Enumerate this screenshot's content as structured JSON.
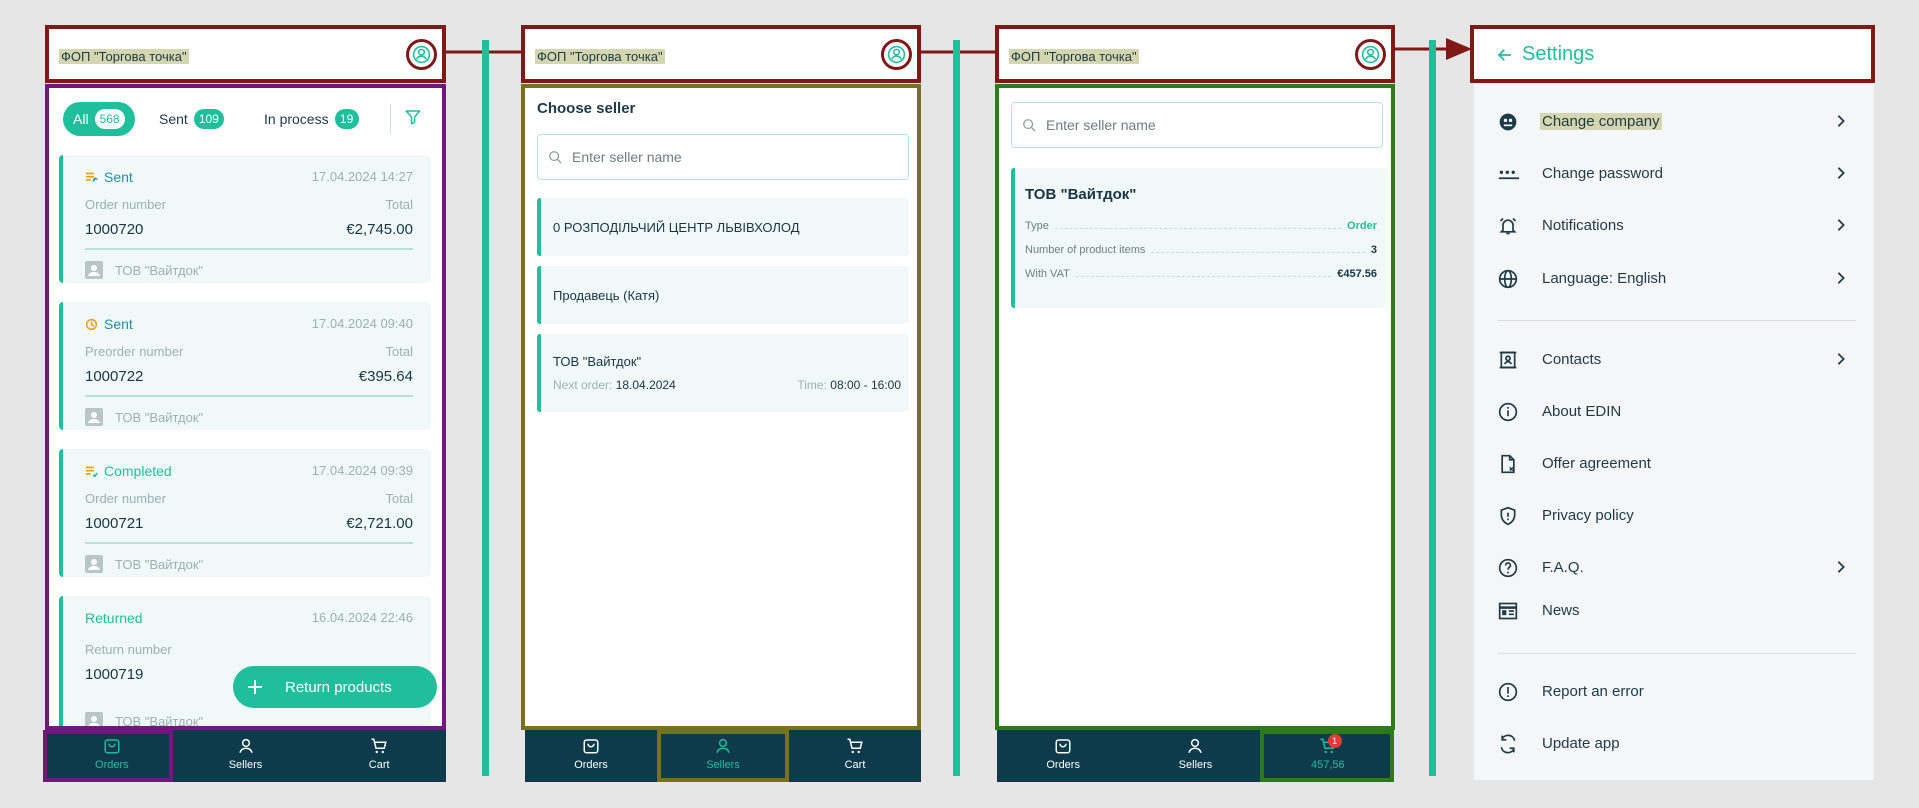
{
  "company_name": "ФОП \"Торгова точка\"",
  "colors": {
    "accent": "#1fbf9b",
    "nav_bg": "#0d3b4c",
    "callout": "#801818",
    "panel1": "#701880",
    "panel2": "#7a7018",
    "panel3": "#2d7a18",
    "highlight": "#d3d6ae"
  },
  "nav": {
    "orders": "Orders",
    "sellers": "Sellers",
    "cart": "Cart",
    "cart_total": "457,56",
    "cart_badge": "1"
  },
  "orders": {
    "filters": [
      {
        "label": "All",
        "count": "568"
      },
      {
        "label": "Sent",
        "count": "109"
      },
      {
        "label": "In process",
        "count": "19"
      }
    ],
    "cards": [
      {
        "status": "Sent",
        "date": "17.04.2024 14:27",
        "label": "Order number",
        "total_label": "Total",
        "number": "1000720",
        "amount": "€2,745.00",
        "seller": "ТОВ \"Вайтдок\""
      },
      {
        "status": "Sent",
        "date": "17.04.2024 09:40",
        "label": "Preorder number",
        "total_label": "Total",
        "number": "1000722",
        "amount": "€395.64",
        "seller": "ТОВ \"Вайтдок\""
      },
      {
        "status": "Completed",
        "date": "17.04.2024 09:39",
        "label": "Order number",
        "total_label": "Total",
        "number": "1000721",
        "amount": "€2,721.00",
        "seller": "ТОВ \"Вайтдок\""
      },
      {
        "status": "Returned",
        "date": "16.04.2024 22:46",
        "label": "Return number",
        "number": "1000719",
        "seller": "ТОВ \"Вайтдок\""
      }
    ],
    "return_button": "Return products"
  },
  "sellers": {
    "title": "Choose seller",
    "search_placeholder": "Enter seller name",
    "items": [
      {
        "name": "0 РОЗПОДІЛЬЧИЙ ЦЕНТР ЛЬВІВХОЛОД"
      },
      {
        "name": "Продавець (Катя)"
      },
      {
        "name": "ТОВ \"Вайтдок\"",
        "next_label": "Next order:",
        "next_value": "18.04.2024",
        "time_label": "Time:",
        "time_value": "08:00 - 16:00"
      }
    ]
  },
  "cart": {
    "search_placeholder": "Enter seller name",
    "seller": "ТОВ \"Вайтдок\"",
    "rows": [
      {
        "key": "Type",
        "value": "Order"
      },
      {
        "key": "Number of product items",
        "value": "3"
      },
      {
        "key": "With VAT",
        "value": "€457.56"
      }
    ]
  },
  "settings": {
    "title": "Settings",
    "items": [
      {
        "label": "Change company",
        "icon": "company-icon",
        "chevron": true
      },
      {
        "label": "Change password",
        "icon": "password-icon",
        "chevron": true
      },
      {
        "label": "Notifications",
        "icon": "bell-icon",
        "chevron": true
      },
      {
        "label": "Language: English",
        "icon": "globe-icon",
        "chevron": true
      },
      {
        "label": "Contacts",
        "icon": "contacts-icon",
        "chevron": true
      },
      {
        "label": "About EDIN",
        "icon": "info-icon",
        "chevron": false
      },
      {
        "label": "Offer agreement",
        "icon": "document-icon",
        "chevron": false
      },
      {
        "label": "Privacy policy",
        "icon": "shield-icon",
        "chevron": false
      },
      {
        "label": "F.A.Q.",
        "icon": "question-icon",
        "chevron": true
      },
      {
        "label": "News",
        "icon": "news-icon",
        "chevron": false
      },
      {
        "label": "Report an error",
        "icon": "alert-icon",
        "chevron": false
      },
      {
        "label": "Update app",
        "icon": "refresh-icon",
        "chevron": false
      }
    ]
  }
}
